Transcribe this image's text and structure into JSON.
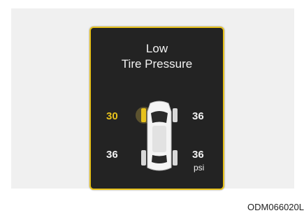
{
  "warning": {
    "title_line1": "Low",
    "title_line2": "Tire Pressure"
  },
  "tires": {
    "front_left": "30",
    "front_right": "36",
    "rear_left": "36",
    "rear_right": "36",
    "unit": "psi",
    "low_tire": "front-left"
  },
  "colors": {
    "accent": "#e8c21c",
    "panel_bg": "#232323",
    "text": "#f2f2f2"
  },
  "caption": "ODM066020L"
}
